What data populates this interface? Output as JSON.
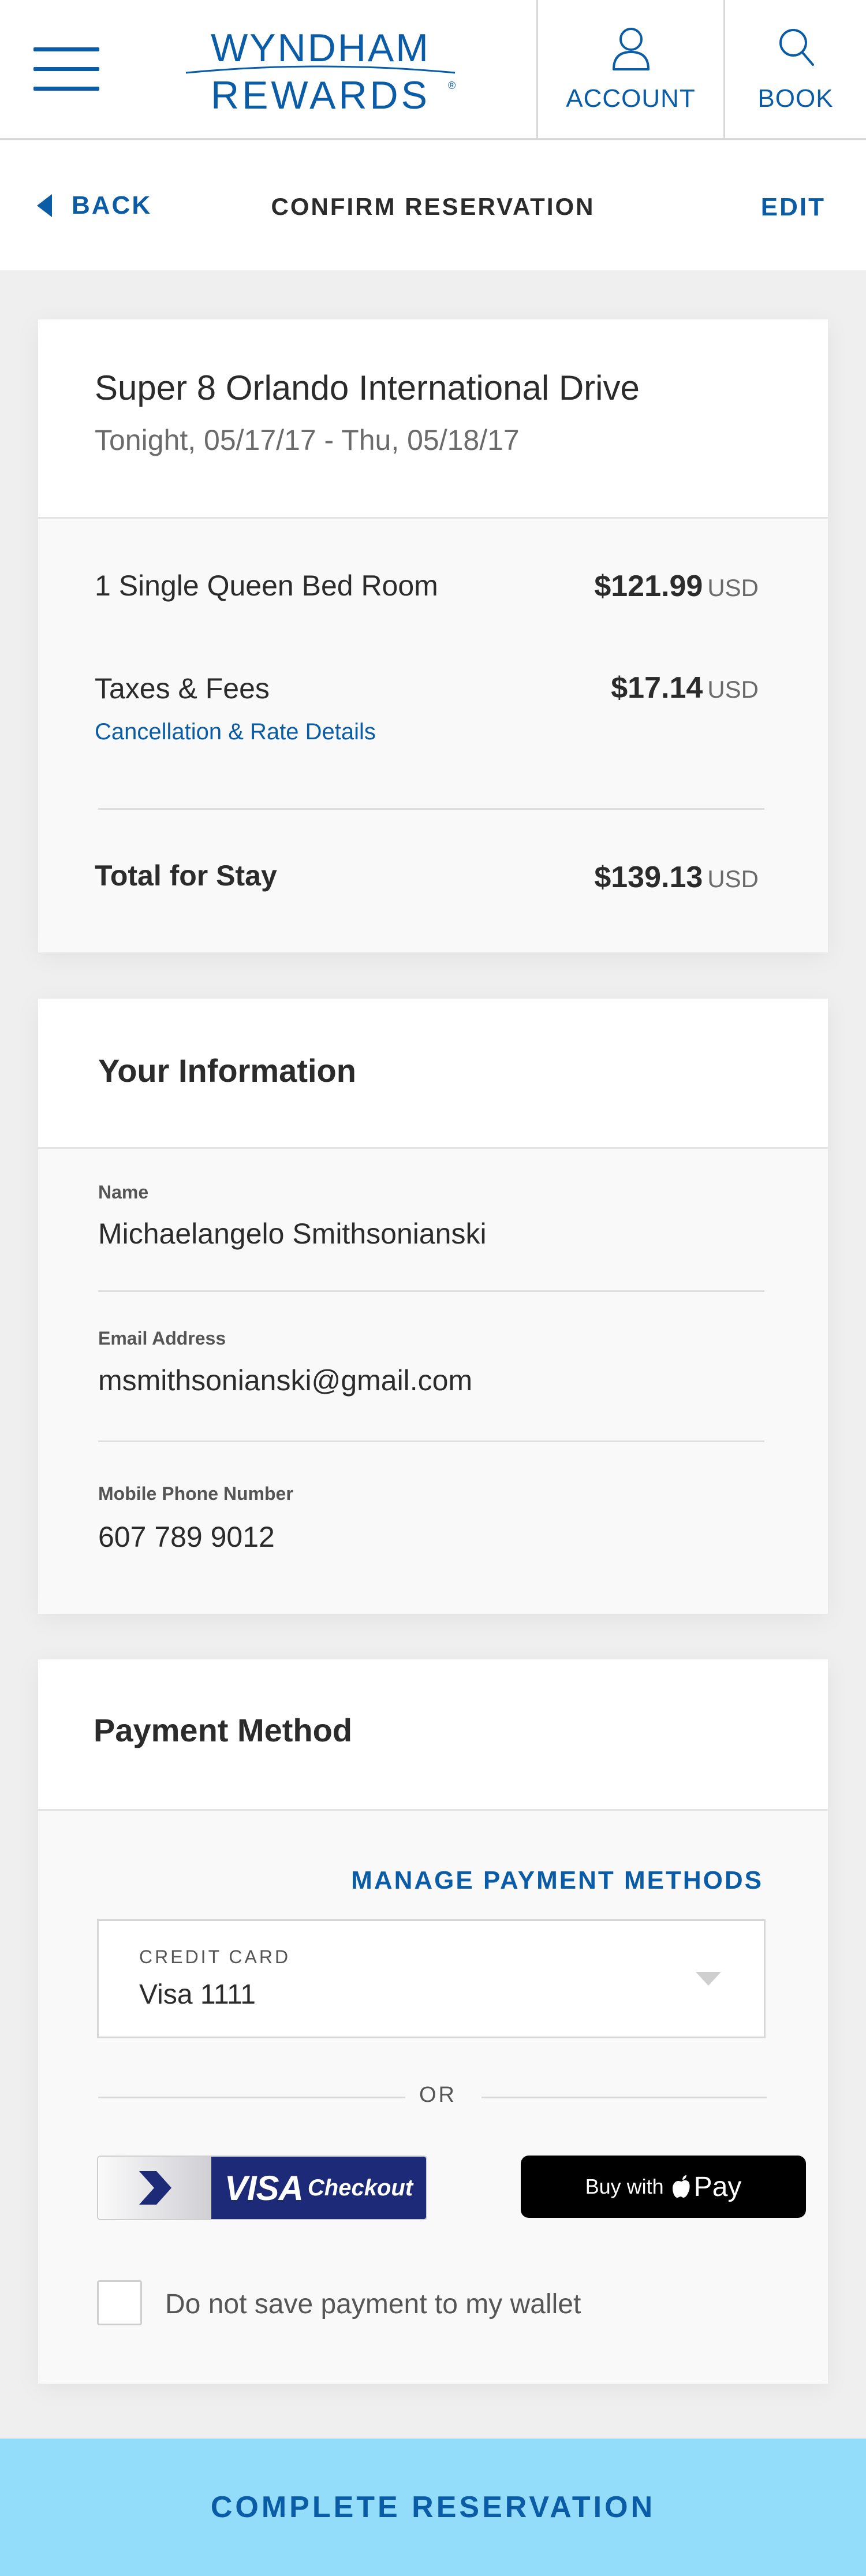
{
  "header": {
    "logo_line1": "WYNDHAM",
    "logo_line2": "REWARDS",
    "logo_mark": "®",
    "account_label": "ACCOUNT",
    "book_label": "BOOK",
    "icons": [
      "menu-icon",
      "user-icon",
      "search-icon"
    ]
  },
  "subheader": {
    "back_label": "BACK",
    "title": "CONFIRM RESERVATION",
    "edit_label": "EDIT"
  },
  "reservation": {
    "hotel_name": "Super 8 Orlando International Drive",
    "dates": "Tonight, 05/17/17 - Thu, 05/18/17",
    "room_label": "1 Single Queen Bed Room",
    "room_price": "$121.99",
    "room_currency": "USD",
    "taxes_label": "Taxes & Fees",
    "taxes_price": "$17.14",
    "taxes_currency": "USD",
    "details_link": "Cancellation & Rate Details",
    "total_label": "Total for Stay",
    "total_price": "$139.13",
    "total_currency": "USD"
  },
  "info": {
    "title": "Your Information",
    "name_label": "Name",
    "name_value": "Michaelangelo Smithsonianski",
    "email_label": "Email Address",
    "email_value": "msmithsonianski@gmail.com",
    "phone_label": "Mobile Phone Number",
    "phone_value": "607 789 9012"
  },
  "payment": {
    "title": "Payment Method",
    "manage_link": "MANAGE PAYMENT METHODS",
    "card_label": "CREDIT CARD",
    "card_value": "Visa 1111",
    "or_label": "OR",
    "visa_brand": "VISA",
    "visa_checkout": "Checkout",
    "applepay_prefix": "Buy with",
    "applepay_suffix": "Pay",
    "nosave_label": "Do not save payment to my wallet",
    "nosave_checked": false
  },
  "cta": {
    "label": "COMPLETE RESERVATION",
    "background": "#93dcfa"
  },
  "colors": {
    "brand_blue": "#0a5ca6",
    "text": "#2b2b2b",
    "muted": "#6b6b6b",
    "visa_navy": "#1c2a78"
  }
}
